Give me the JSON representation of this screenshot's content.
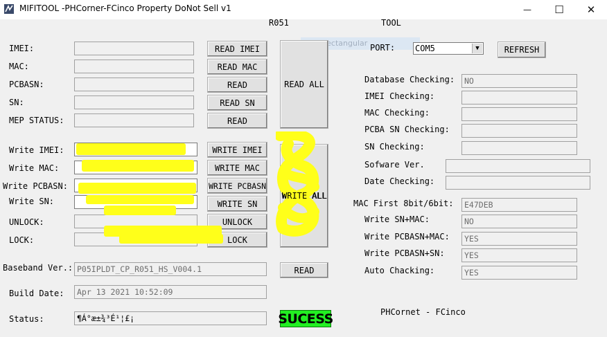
{
  "window": {
    "title": "MIFITOOL -PHCorner-FCinco Property DoNot Sell v1",
    "minimize_glyph": "—",
    "maximize_glyph": "☐",
    "close_glyph": "✕"
  },
  "header": {
    "model": "R051",
    "tool": "TOOL"
  },
  "overlay_hint": "Rectangular",
  "read_section": {
    "labels": [
      "IMEI:",
      "MAC:",
      "PCBASN:",
      "SN:",
      "MEP STATUS:"
    ],
    "buttons": [
      "READ IMEI",
      "READ MAC",
      "READ",
      "READ SN",
      "READ"
    ],
    "values": [
      "",
      "",
      "",
      "",
      ""
    ],
    "read_all": "READ ALL"
  },
  "write_section": {
    "labels": [
      "Write IMEI:",
      "Write MAC:",
      "Write PCBASN:",
      "Write SN:",
      "UNLOCK:",
      "LOCK:"
    ],
    "buttons": [
      "WRITE IMEI",
      "WRITE MAC",
      "WRITE PCBASN",
      "WRITE SN",
      "UNLOCK",
      "LOCK"
    ],
    "values": [
      "",
      "",
      "",
      "",
      "",
      ""
    ],
    "write_all": "WRITE ALL"
  },
  "baseband": {
    "label": "Baseband Ver.:",
    "value": "P05IPLDT_CP_R051_HS_V004.1",
    "read_button": "READ"
  },
  "build_date": {
    "label": "Build Date:",
    "value": "Apr 13 2021  10:52:09"
  },
  "status": {
    "label": "Status:",
    "value": "¶Á°æ±¾³É¹¦£¡",
    "badge": "SUCESS",
    "badge_color": "#22ef22"
  },
  "port": {
    "label": "PORT:",
    "selected": "COM5",
    "refresh_button": "REFRESH"
  },
  "checks": [
    {
      "label": "Database Checking:",
      "value": "NO"
    },
    {
      "label": "IMEI Checking:",
      "value": ""
    },
    {
      "label": "MAC Checking:",
      "value": ""
    },
    {
      "label": "PCBA SN Checking:",
      "value": ""
    },
    {
      "label": "SN Checking:",
      "value": ""
    },
    {
      "label": "Sofware Ver.",
      "value": ""
    },
    {
      "label": "Date Checking:",
      "value": ""
    }
  ],
  "settings": [
    {
      "label": "MAC First 8bit/6bit:",
      "value": "E47DEB"
    },
    {
      "label": "Write SN+MAC:",
      "value": "NO"
    },
    {
      "label": "Write PCBASN+MAC:",
      "value": "YES"
    },
    {
      "label": "Write PCBASN+SN:",
      "value": "YES"
    },
    {
      "label": "Auto Chacking:",
      "value": "YES"
    }
  ],
  "footer_credit": "PHCornet - FCinco",
  "highlight_color": "#ffff1a"
}
